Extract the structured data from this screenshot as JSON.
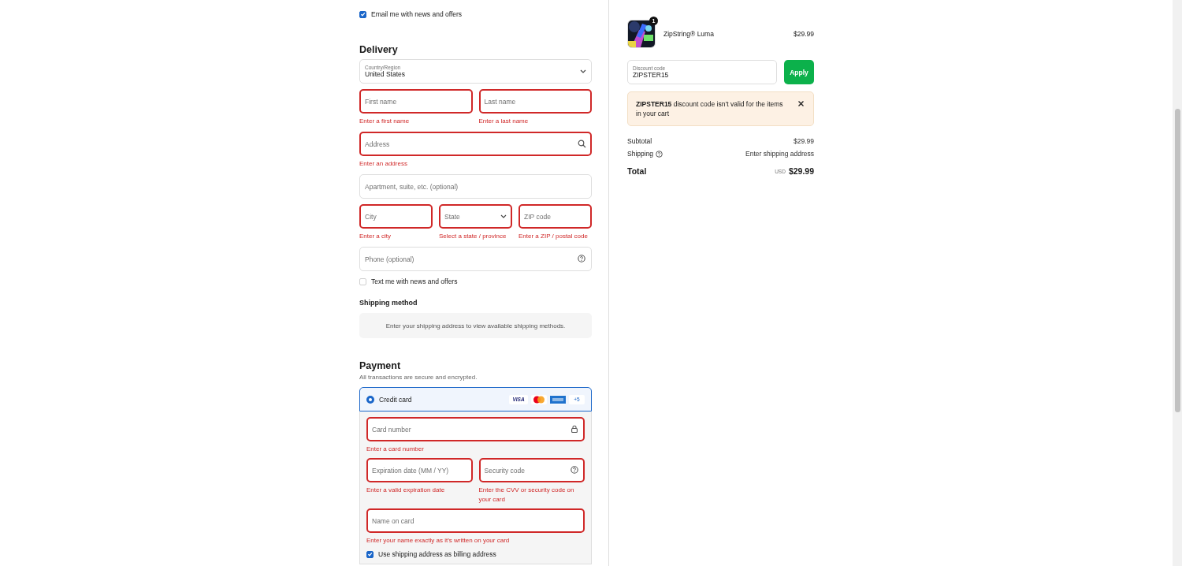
{
  "email_optin": {
    "label": "Email me with news and offers",
    "checked": true
  },
  "delivery": {
    "title": "Delivery",
    "rows": [
      [
        {
          "kind": "select",
          "label": "Country/Region",
          "value": "United States"
        }
      ],
      [
        {
          "kind": "text",
          "placeholder": "First name",
          "error": "Enter a first name"
        },
        {
          "kind": "text",
          "placeholder": "Last name",
          "error": "Enter a last name"
        }
      ],
      [
        {
          "kind": "search",
          "placeholder": "Address",
          "error": "Enter an address"
        }
      ],
      [
        {
          "kind": "text",
          "placeholder": "Apartment, suite, etc. (optional)"
        }
      ],
      [
        {
          "kind": "text",
          "placeholder": "City",
          "error": "Enter a city"
        },
        {
          "kind": "select",
          "placeholder": "State",
          "error": "Select a state / province"
        },
        {
          "kind": "text",
          "placeholder": "ZIP code",
          "error": "Enter a ZIP / postal code"
        }
      ],
      [
        {
          "kind": "help",
          "placeholder": "Phone (optional)"
        }
      ]
    ]
  },
  "sms_optin": {
    "label": "Text me with news and offers",
    "checked": false
  },
  "shipping_method": {
    "title": "Shipping method",
    "message": "Enter your shipping address to view available shipping methods."
  },
  "payment": {
    "title": "Payment",
    "subtitle": "All transactions are secure and encrypted.",
    "method": {
      "label": "Credit card",
      "selected": true,
      "brands": [
        {
          "kind": "visa",
          "label": "VISA"
        },
        {
          "kind": "mastercard"
        },
        {
          "kind": "amex"
        },
        {
          "kind": "more",
          "label": "+5"
        }
      ]
    },
    "rows": [
      [
        {
          "kind": "secure",
          "placeholder": "Card number",
          "error": "Enter a card number"
        }
      ],
      [
        {
          "kind": "text",
          "placeholder": "Expiration date (MM / YY)",
          "error": "Enter a valid expiration date"
        },
        {
          "kind": "help",
          "placeholder": "Security code",
          "error": "Enter the CVV or security code on your card"
        }
      ],
      [
        {
          "kind": "text",
          "placeholder": "Name on card",
          "error": "Enter your name exactly as it’s written on your card"
        }
      ]
    ],
    "billing": {
      "label": "Use shipping address as billing address",
      "checked": true
    }
  },
  "summary": {
    "product": {
      "name": "ZipString® Luma",
      "price": "$29.99",
      "quantity": "1"
    },
    "discount": {
      "label": "Discount code",
      "value": "ZIPSTER15",
      "button": "Apply"
    },
    "alert": {
      "message": "**ZIPSTER15** discount code isn’t valid for the items in your cart"
    },
    "lines": [
      {
        "label": "Subtotal",
        "value": "$29.99"
      },
      {
        "label": "Shipping",
        "value": "Enter shipping address",
        "help": true
      }
    ],
    "total": {
      "label": "Total",
      "currency": "USD",
      "value": "$29.99"
    }
  }
}
